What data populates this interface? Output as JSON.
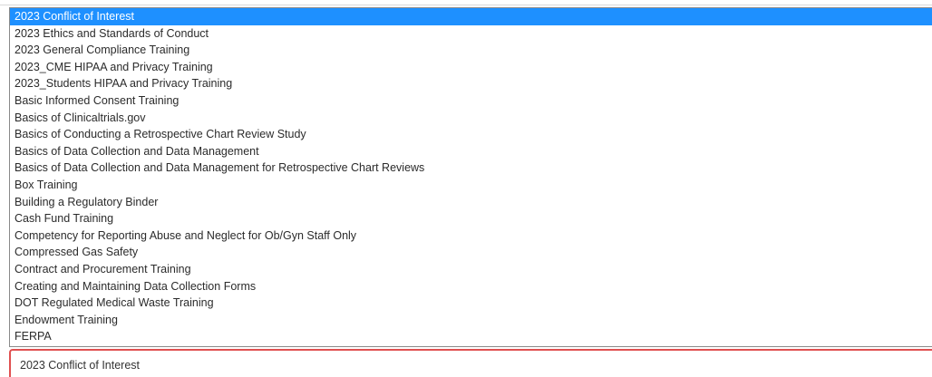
{
  "options": [
    "2023 Conflict of Interest",
    "2023 Ethics and Standards of Conduct",
    "2023 General Compliance Training",
    "2023_CME HIPAA and Privacy Training",
    "2023_Students HIPAA and Privacy Training",
    "Basic Informed Consent Training",
    "Basics of Clinicaltrials.gov",
    "Basics of Conducting a Retrospective Chart Review Study",
    "Basics of Data Collection and Data Management",
    "Basics of Data Collection and Data Management for Retrospective Chart Reviews",
    "Box Training",
    "Building a Regulatory Binder",
    "Cash Fund Training",
    "Competency for Reporting Abuse and Neglect for Ob/Gyn Staff Only",
    "Compressed Gas Safety",
    "Contract and Procurement Training",
    "Creating and Maintaining Data Collection Forms",
    "DOT Regulated Medical Waste Training",
    "Endowment Training",
    "FERPA"
  ],
  "selected_value": "2023 Conflict of Interest",
  "colors": {
    "highlight": "#1e90ff",
    "focus_border": "#e05050"
  }
}
